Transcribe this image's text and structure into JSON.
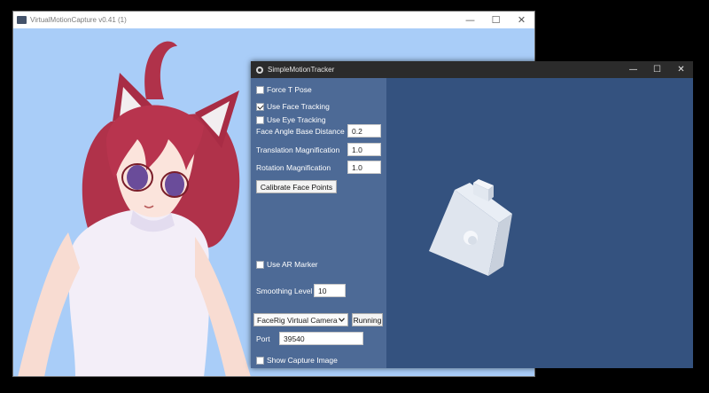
{
  "vmc_window": {
    "title": "VirtualMotionCapture v0.41 (1)",
    "app_icon": "vmc-app-icon",
    "controls": {
      "minimize": "—",
      "maximize": "☐",
      "close": "✕"
    },
    "background_color": "#a9cdf8"
  },
  "smt_window": {
    "title": "SimpleMotionTracker",
    "app_icon": "smt-app-icon",
    "controls": {
      "minimize": "—",
      "maximize": "☐",
      "close": "✕"
    },
    "panel": {
      "force_t_pose": {
        "label": "Force T Pose",
        "checked": false
      },
      "use_face_tracking": {
        "label": "Use Face Tracking",
        "checked": true
      },
      "use_eye_tracking": {
        "label": "Use Eye Tracking",
        "checked": false
      },
      "face_angle_base_distance": {
        "label": "Face Angle Base Distance",
        "value": "0.2"
      },
      "translation_magnification": {
        "label": "Translation Magnification",
        "value": "1.0"
      },
      "rotation_magnification": {
        "label": "Rotation Magnification",
        "value": "1.0"
      },
      "calibrate_button": "Calibrate Face Points",
      "use_ar_marker": {
        "label": "Use AR Marker",
        "checked": false
      },
      "smoothing_level": {
        "label": "Smoothing Level",
        "value": "10"
      },
      "camera_select": {
        "selected": "FaceRig Virtual Camera",
        "icon": "chevron-down-icon"
      },
      "running_button": "Running",
      "port": {
        "label": "Port",
        "value": "39540"
      },
      "show_capture_image": {
        "label": "Show Capture Image",
        "checked": false
      }
    }
  },
  "colors": {
    "panel_bg": "#4d6a96",
    "view_bg": "#34527f",
    "titlebar_dark": "#2b2b2b"
  }
}
